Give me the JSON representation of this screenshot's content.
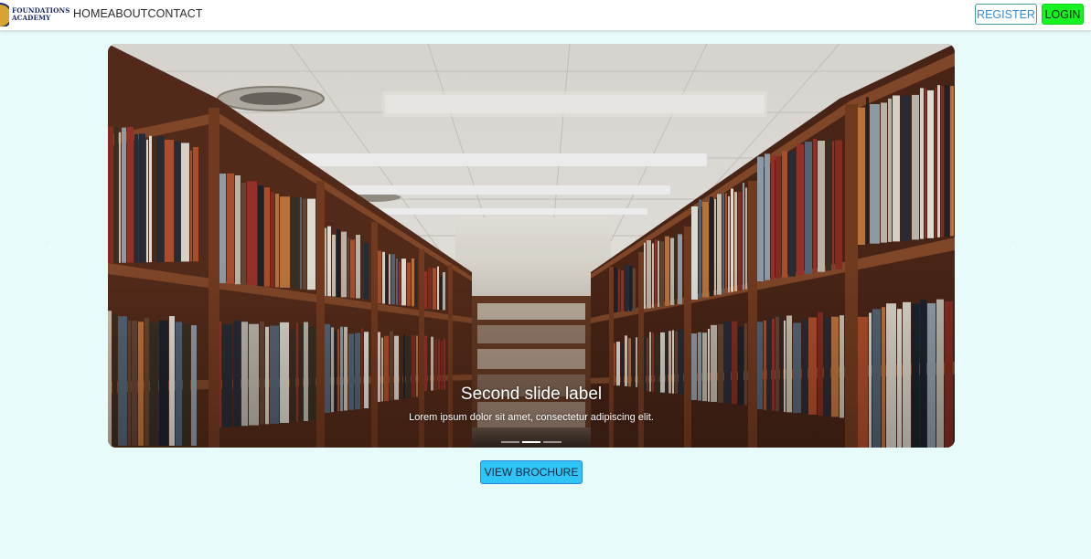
{
  "navbar": {
    "brand": {
      "line1": "FOUNDATIONS",
      "line2": "ACADEMY"
    },
    "links": [
      "HOME",
      "ABOUT",
      "CONTACT"
    ],
    "register_label": "REGISTER",
    "login_label": "LOGIN"
  },
  "carousel": {
    "active_slide": 2,
    "slide_count": 3,
    "caption": {
      "title": "Second slide label",
      "text": "Lorem ipsum dolor sit amet, consectetur adipiscing elit."
    },
    "prev_icon": "chevron-left-icon",
    "next_icon": "chevron-right-icon"
  },
  "brochure_label": "VIEW BROCHURE",
  "colors": {
    "page_bg": "#e8fbfb",
    "login_bg": "#16f321",
    "register_border": "#3d9a9a",
    "brochure_bg": "#2ec4f6"
  }
}
